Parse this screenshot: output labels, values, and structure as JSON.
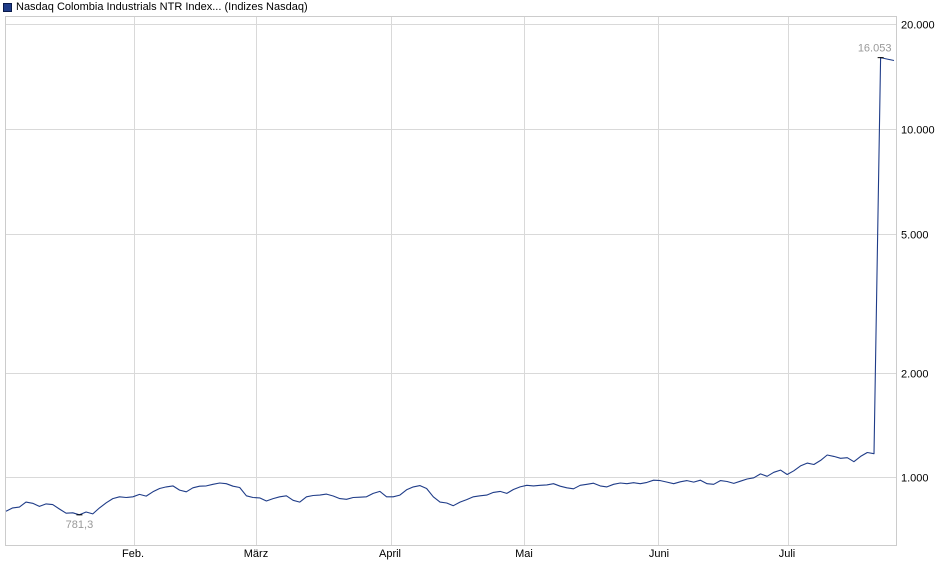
{
  "legend": {
    "label": "Nasdaq Colombia Industrials NTR Index... (Indizes Nasdaq)",
    "color": "#1f3c88"
  },
  "chart_data": {
    "type": "line",
    "title": "",
    "xlabel": "",
    "ylabel": "",
    "y_scale": "log",
    "ylim": [
      640,
      21000
    ],
    "grid": true,
    "legend_position": "top-left",
    "x_ticks": [
      "Feb.",
      "März",
      "April",
      "Mai",
      "Juni",
      "Juli"
    ],
    "y_ticks": [
      "20.000",
      "10.000",
      "5.000",
      "2.000",
      "1.000"
    ],
    "annotations": [
      {
        "label": "781,3",
        "at": "min"
      },
      {
        "label": "16.053",
        "at": "max"
      }
    ],
    "series": [
      {
        "color": "#1f3c88",
        "values": [
          800,
          818,
          822,
          850,
          843,
          826,
          840,
          836,
          812,
          790,
          792,
          781.3,
          796,
          786,
          818,
          846,
          870,
          880,
          876,
          880,
          894,
          884,
          910,
          930,
          940,
          946,
          920,
          910,
          934,
          944,
          946,
          956,
          964,
          960,
          944,
          936,
          886,
          876,
          874,
          856,
          870,
          880,
          886,
          860,
          850,
          880,
          888,
          890,
          896,
          885,
          870,
          866,
          876,
          878,
          880,
          900,
          912,
          880,
          880,
          890,
          922,
          940,
          948,
          930,
          880,
          850,
          845,
          830,
          850,
          864,
          880,
          886,
          890,
          906,
          912,
          900,
          924,
          940,
          950,
          946,
          950,
          952,
          960,
          944,
          934,
          928,
          950,
          956,
          963,
          946,
          940,
          956,
          964,
          960,
          966,
          960,
          968,
          982,
          980,
          970,
          960,
          972,
          980,
          970,
          982,
          960,
          956,
          980,
          974,
          962,
          976,
          990,
          998,
          1024,
          1008,
          1035,
          1050,
          1020,
          1045,
          1080,
          1100,
          1090,
          1120,
          1160,
          1150,
          1135,
          1140,
          1110,
          1150,
          1180,
          1170,
          16053,
          15900,
          15750
        ]
      }
    ]
  }
}
